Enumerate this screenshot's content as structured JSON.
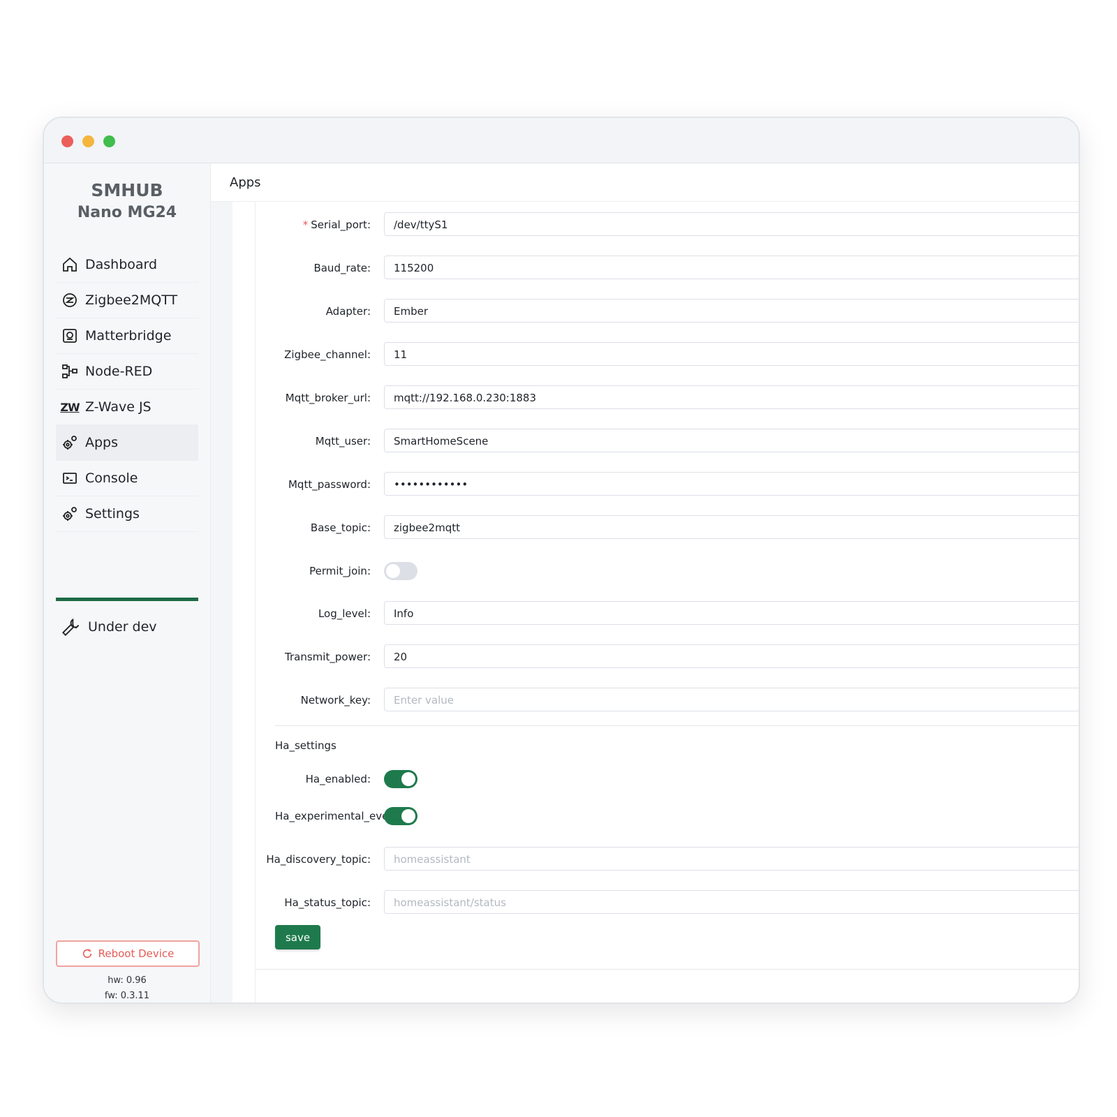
{
  "sidebar": {
    "brand_line1": "SMHUB",
    "brand_line2": "Nano MG24",
    "items": [
      {
        "label": "Dashboard",
        "icon": "home-icon"
      },
      {
        "label": "Zigbee2MQTT",
        "icon": "zigbee-icon"
      },
      {
        "label": "Matterbridge",
        "icon": "matter-icon"
      },
      {
        "label": "Node-RED",
        "icon": "node-red-icon"
      },
      {
        "label": "Z-Wave JS",
        "icon": "zwave-icon",
        "icon_text": "ZW"
      },
      {
        "label": "Apps",
        "icon": "apps-gear-icon",
        "active": true
      },
      {
        "label": "Console",
        "icon": "console-icon"
      },
      {
        "label": "Settings",
        "icon": "settings-gear-icon"
      }
    ],
    "under_dev": "Under dev",
    "reboot_label": "Reboot Device",
    "hw": "hw: 0.96",
    "fw": "fw: 0.3.11"
  },
  "main": {
    "title": "Apps",
    "fields": [
      {
        "label": "Serial_port",
        "value": "/dev/ttyS1",
        "required": true
      },
      {
        "label": "Baud_rate",
        "value": "115200"
      },
      {
        "label": "Adapter",
        "value": "Ember"
      },
      {
        "label": "Zigbee_channel",
        "value": "11"
      },
      {
        "label": "Mqtt_broker_url",
        "value": "mqtt://192.168.0.230:1883"
      },
      {
        "label": "Mqtt_user",
        "value": "SmartHomeScene"
      },
      {
        "label": "Mqtt_password",
        "value": "••••••••••••"
      },
      {
        "label": "Base_topic",
        "value": "zigbee2mqtt"
      },
      {
        "label": "Permit_join",
        "toggle": false
      },
      {
        "label": "Log_level",
        "value": "Info"
      },
      {
        "label": "Transmit_power",
        "value": "20"
      },
      {
        "label": "Network_key",
        "placeholder": "Enter value"
      }
    ],
    "ha_section_title": "Ha_settings",
    "ha_fields": [
      {
        "label": "Ha_enabled",
        "toggle": true
      },
      {
        "label": "Ha_experimental_even",
        "toggle": true
      },
      {
        "label": "Ha_discovery_topic",
        "placeholder": "homeassistant"
      },
      {
        "label": "Ha_status_topic",
        "placeholder": "homeassistant/status"
      }
    ],
    "save_label": "save"
  },
  "colors": {
    "accent": "#1e7a4c",
    "danger": "#e45b56"
  }
}
